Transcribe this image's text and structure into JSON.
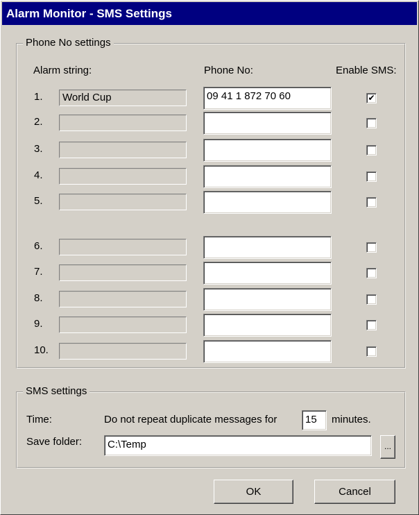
{
  "window": {
    "title": "Alarm Monitor - SMS Settings"
  },
  "phone_group": {
    "legend": "Phone No settings",
    "header_alarm": "Alarm string:",
    "header_phone": "Phone No:",
    "header_enable": "Enable SMS:",
    "rows": [
      {
        "num": "1.",
        "alarm": "World Cup",
        "phone": "09 41 1 872 70 60",
        "enabled": true
      },
      {
        "num": "2.",
        "alarm": "",
        "phone": "",
        "enabled": false
      },
      {
        "num": "3.",
        "alarm": "",
        "phone": "",
        "enabled": false
      },
      {
        "num": "4.",
        "alarm": "",
        "phone": "",
        "enabled": false
      },
      {
        "num": "5.",
        "alarm": "",
        "phone": "",
        "enabled": false
      },
      {
        "num": "6.",
        "alarm": "",
        "phone": "",
        "enabled": false
      },
      {
        "num": "7.",
        "alarm": "",
        "phone": "",
        "enabled": false
      },
      {
        "num": "8.",
        "alarm": "",
        "phone": "",
        "enabled": false
      },
      {
        "num": "9.",
        "alarm": "",
        "phone": "",
        "enabled": false
      },
      {
        "num": "10.",
        "alarm": "",
        "phone": "",
        "enabled": false
      }
    ]
  },
  "sms_group": {
    "legend": "SMS settings",
    "time_label": "Time:",
    "repeat_text": "Do not repeat duplicate messages for",
    "minutes_value": "15",
    "minutes_label": "minutes.",
    "folder_label": "Save folder:",
    "folder_value": "C:\\Temp",
    "browse_label": "..."
  },
  "buttons": {
    "ok": "OK",
    "cancel": "Cancel"
  },
  "check_mark": "✔"
}
